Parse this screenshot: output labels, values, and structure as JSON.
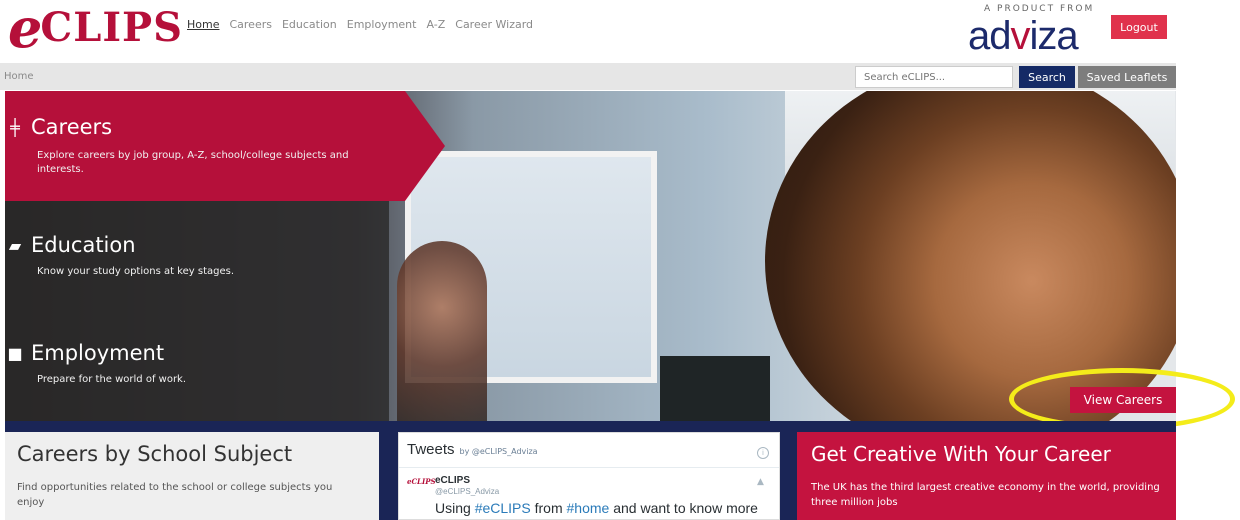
{
  "header": {
    "logo_e": "e",
    "logo_rest": "CLIPS",
    "nav": [
      "Home",
      "Careers",
      "Education",
      "Employment",
      "A-Z",
      "Career Wizard"
    ],
    "product_from": "A PRODUCT FROM",
    "brand_part1": "ad",
    "brand_v": "v",
    "brand_part2": "iza",
    "logout_label": "Logout"
  },
  "crumbbar": {
    "breadcrumb": "Home",
    "search_placeholder": "Search eCLIPS...",
    "search_label": "Search",
    "saved_label": "Saved Leaflets"
  },
  "hero": {
    "careers": {
      "title": "Careers",
      "desc": "Explore careers by job group, A-Z, school/college subjects and interests.",
      "icon": "signpost-icon"
    },
    "education": {
      "title": "Education",
      "desc": "Know your study options at key stages.",
      "icon": "book-icon"
    },
    "employment": {
      "title": "Employment",
      "desc": "Prepare for the world of work.",
      "icon": "briefcase-icon"
    },
    "cta_label": "View Careers"
  },
  "cards": {
    "subject": {
      "title": "Careers by School Subject",
      "desc": "Find opportunities related to the school or college subjects you enjoy"
    },
    "tweets": {
      "title": "Tweets",
      "by": "by @eCLIPS_Adviza",
      "avatar": "eCLIPS",
      "name": "eCLIPS",
      "handle": "@eCLIPS_Adviza",
      "text_pre": "Using ",
      "tag1": "#eCLIPS",
      "text_mid": " from ",
      "tag2": "#home",
      "text_post": " and want to know more"
    },
    "creative": {
      "title": "Get Creative With Your Career",
      "desc": "The UK has the third largest creative economy in the world, providing three million jobs"
    }
  },
  "colors": {
    "brand_red": "#b5103a",
    "cta_red": "#c4133f",
    "navy": "#152a66",
    "highlight": "#f4ec1a"
  }
}
